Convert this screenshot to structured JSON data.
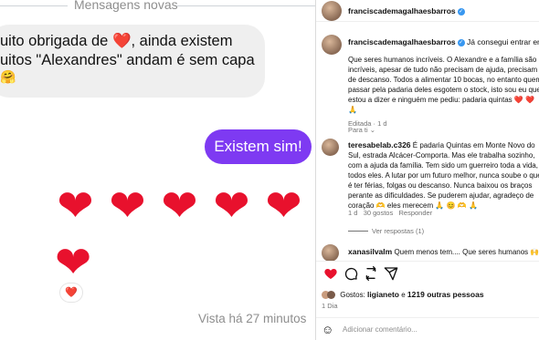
{
  "chat": {
    "divider_label": "Mensagens novas",
    "incoming_line1": "uito obrigada de ",
    "incoming_heart": "❤️",
    "incoming_line1_rest": ", ainda existem",
    "incoming_line2": "uitos \"Alexandres\" andam é sem capa",
    "incoming_emoji": "🤗",
    "outgoing_message": "Existem sim!",
    "hearts": [
      "❤",
      "❤",
      "❤",
      "❤",
      "❤",
      "❤"
    ],
    "reaction": "❤️",
    "seen_text": "Vista há 27 minutos"
  },
  "post": {
    "username": "franciscademagalhaesbarros",
    "caption_username": "franciscademagalhaesbarros",
    "caption_lead": "Já consegui entrar em contacto",
    "caption_text": "Que seres humanos incríveis. O Alexandre e a família são incríveis, apesar de tudo não precisam de ajuda, precisam de descanso. Todos a alimentar 10 bocas, no entanto quem passar pela padaria deles esgotem o stock, isto sou eu que estou a dizer e ninguém me pediu: padaria quintas",
    "caption_emojis": "❤️ ❤️ 🙏",
    "caption_meta": "Editada · 1 d",
    "see_translation": "Para ti",
    "comment1_username": "teresabelab.c326",
    "comment1_text": "É padaria Quintas em Monte Novo do Sul, estrada Alcácer-Comporta. Mas ele trabalha sozinho, com a ajuda da família. Tem sido um guerreiro toda a vida, todos eles. A lutar por um futuro melhor, nunca soube o que é ter férias, folgas ou descanso. Nunca baixou os braços perante as dificuldades. Se puderem ajudar, agradeço de coração",
    "comment1_emojis_a": "🫶",
    "comment1_text2": "eles merecem",
    "comment1_emojis_b": "🙏 😊 🫶 🙏",
    "comment1_time": "1 d",
    "comment1_likes": "30 gostos",
    "comment1_reply": "Responder",
    "view_replies": "Ver respostas (1)",
    "comment2_username": "xanasilvalm",
    "comment2_text": "Quem menos tem.... Que seres humanos",
    "comment2_emojis": "🙌 ❤️",
    "likes_label": "Gostos:",
    "likes_user": "ligianeto",
    "likes_and": "e",
    "likes_others": "1219 outras pessoas",
    "post_age": "1 Dia",
    "add_comment_placeholder": "Adicionar comentário..."
  },
  "colors": {
    "outgoing_bubble": "#7e3af2",
    "incoming_bubble": "#efefef",
    "heart": "#e8112d",
    "verified": "#3897f0"
  }
}
